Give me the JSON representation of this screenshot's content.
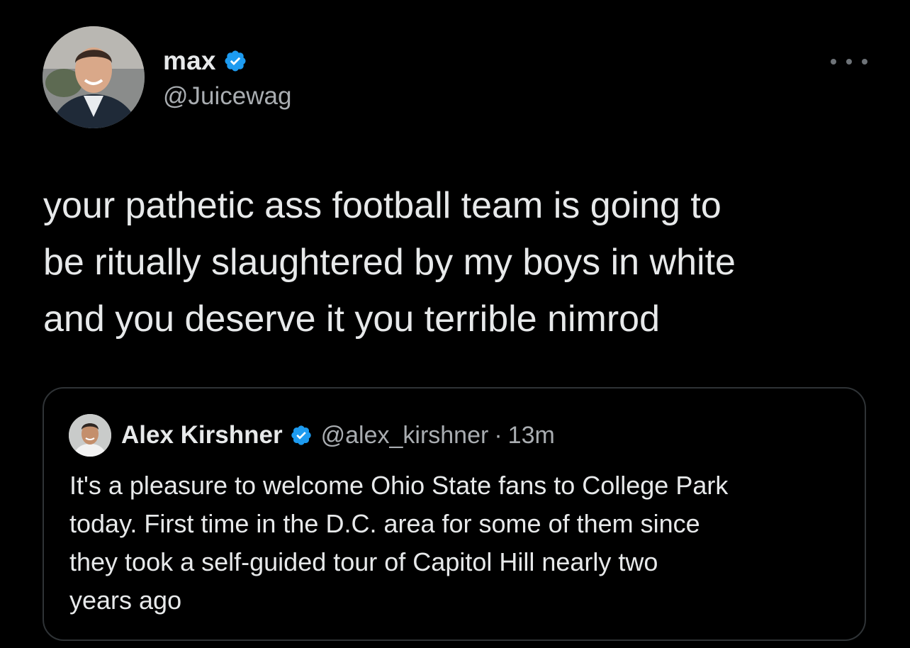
{
  "tweet": {
    "author": {
      "name": "max",
      "handle": "@Juicewag",
      "verified": true,
      "avatar_icon": "profile-photo"
    },
    "more_icon": "more-dots-icon",
    "text": "your pathetic ass football team is going to\nbe ritually slaughtered by my boys in white\nand you deserve it you terrible nimrod"
  },
  "quoted_tweet": {
    "author": {
      "name": "Alex Kirshner",
      "handle": "@alex_kirshner",
      "verified": true,
      "avatar_icon": "profile-photo"
    },
    "separator": "·",
    "time": "13m",
    "text": "It's a pleasure to welcome Ohio State fans to College Park\ntoday. First time in the D.C. area for some of them since\nthey took a self-guided tour of Capitol Hill nearly two\nyears ago"
  },
  "colors": {
    "background": "#000000",
    "text_primary": "#e7e9ea",
    "text_secondary": "#a9adb1",
    "verified_badge": "#1d9bf0",
    "card_border": "#2f3336"
  }
}
